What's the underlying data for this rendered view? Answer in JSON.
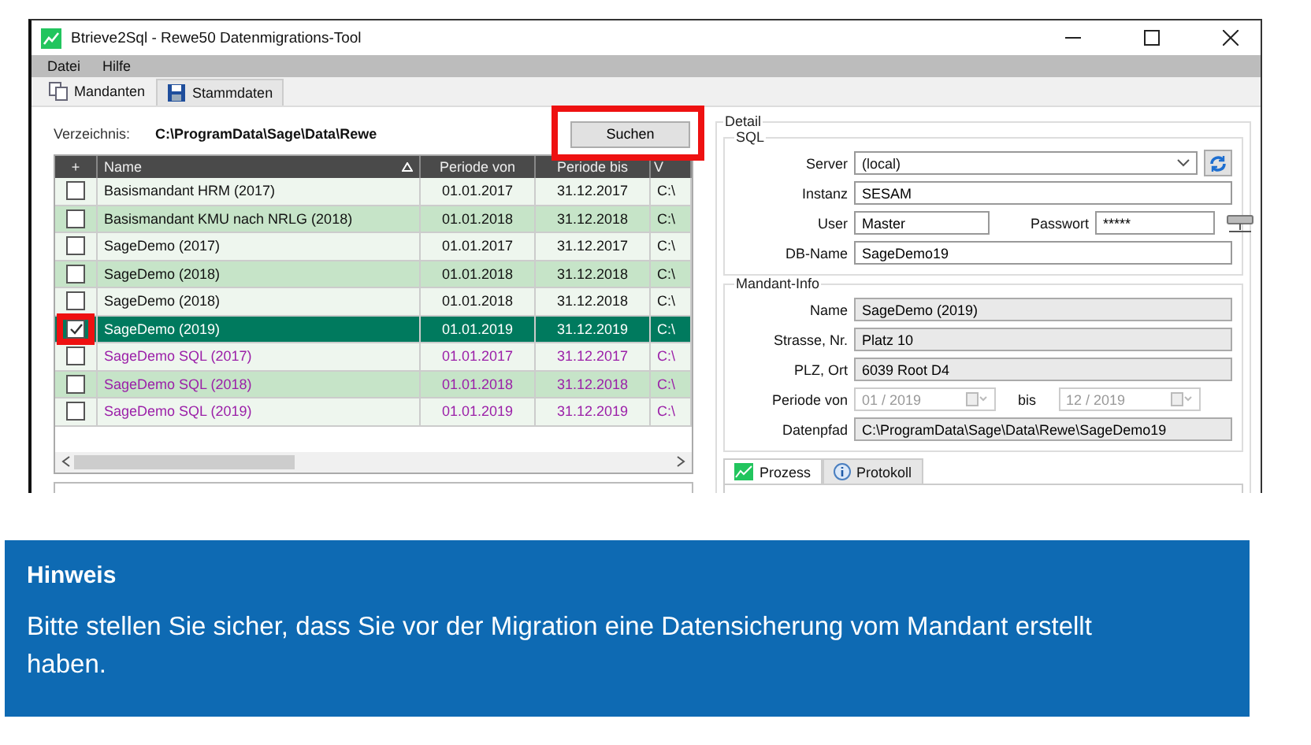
{
  "window": {
    "title": "Btrieve2Sql - Rewe50 Datenmigrations-Tool"
  },
  "menu": [
    "Datei",
    "Hilfe"
  ],
  "tabs": [
    {
      "label": "Mandanten",
      "selected": true
    },
    {
      "label": "Stammdaten",
      "selected": false
    }
  ],
  "directory": {
    "label": "Verzeichnis:",
    "value": "C:\\ProgramData\\Sage\\Data\\Rewe"
  },
  "search_button": {
    "label": "Suchen",
    "highlighted": true
  },
  "table": {
    "checkbox_header": "+",
    "columns": [
      "Name",
      "Periode von",
      "Periode bis",
      "V"
    ],
    "rows": [
      {
        "kind": "btrieve",
        "checked": false,
        "selected": false,
        "highlighted": false,
        "cells": [
          "Basismandant HRM (2017)",
          "01.01.2017",
          "31.12.2017",
          "C:\\"
        ]
      },
      {
        "kind": "btrieve",
        "checked": false,
        "selected": false,
        "highlighted": false,
        "cells": [
          "Basismandant KMU nach NRLG (2018)",
          "01.01.2018",
          "31.12.2018",
          "C:\\"
        ]
      },
      {
        "kind": "btrieve",
        "checked": false,
        "selected": false,
        "highlighted": false,
        "cells": [
          "SageDemo (2017)",
          "01.01.2017",
          "31.12.2017",
          "C:\\"
        ]
      },
      {
        "kind": "btrieve",
        "checked": false,
        "selected": false,
        "highlighted": false,
        "cells": [
          "SageDemo (2018)",
          "01.01.2018",
          "31.12.2018",
          "C:\\"
        ]
      },
      {
        "kind": "btrieve",
        "checked": false,
        "selected": false,
        "highlighted": false,
        "cells": [
          "SageDemo (2018)",
          "01.01.2018",
          "31.12.2018",
          "C:\\"
        ]
      },
      {
        "kind": "btrieve",
        "checked": true,
        "selected": true,
        "highlighted": true,
        "cells": [
          "SageDemo (2019)",
          "01.01.2019",
          "31.12.2019",
          "C:\\"
        ]
      },
      {
        "kind": "sql",
        "checked": false,
        "selected": false,
        "highlighted": false,
        "cells": [
          "SageDemo SQL (2017)",
          "01.01.2017",
          "31.12.2017",
          "C:\\"
        ]
      },
      {
        "kind": "sql",
        "checked": false,
        "selected": false,
        "highlighted": false,
        "cells": [
          "SageDemo SQL (2018)",
          "01.01.2018",
          "31.12.2018",
          "C:\\"
        ]
      },
      {
        "kind": "sql",
        "checked": false,
        "selected": false,
        "highlighted": false,
        "cells": [
          "SageDemo SQL (2019)",
          "01.01.2019",
          "31.12.2019",
          "C:\\"
        ]
      }
    ]
  },
  "detail": {
    "title": "Detail",
    "sql": {
      "title": "SQL",
      "server": {
        "label": "Server",
        "value": "(local)"
      },
      "instanz": {
        "label": "Instanz",
        "value": "SESAM"
      },
      "user": {
        "label": "User",
        "value": "Master"
      },
      "passwort": {
        "label": "Passwort",
        "value": "*****"
      },
      "db_name": {
        "label": "DB-Name",
        "value": "SageDemo19"
      }
    },
    "mandant_info": {
      "title": "Mandant-Info",
      "fields": [
        {
          "label": "Name",
          "value": "SageDemo (2019)"
        },
        {
          "label": "Strasse, Nr.",
          "value": "Platz 10"
        },
        {
          "label": "PLZ, Ort",
          "value": "6039 Root D4"
        }
      ],
      "periode": {
        "label": "Periode von",
        "from": "01 / 2019",
        "to_label": "bis",
        "to": "12 / 2019",
        "disabled": true
      },
      "datenpfad": {
        "label": "Datenpfad",
        "value": "C:\\ProgramData\\Sage\\Data\\Rewe\\SageDemo19"
      }
    },
    "bottom_tabs": [
      {
        "label": "Prozess",
        "selected": true
      },
      {
        "label": "Protokoll",
        "selected": false
      }
    ]
  },
  "hint": {
    "title": "Hinweis",
    "text": "Bitte stellen Sie sicher, dass Sie vor der Migration eine Datensicherung vom Mandant erstellt haben."
  }
}
